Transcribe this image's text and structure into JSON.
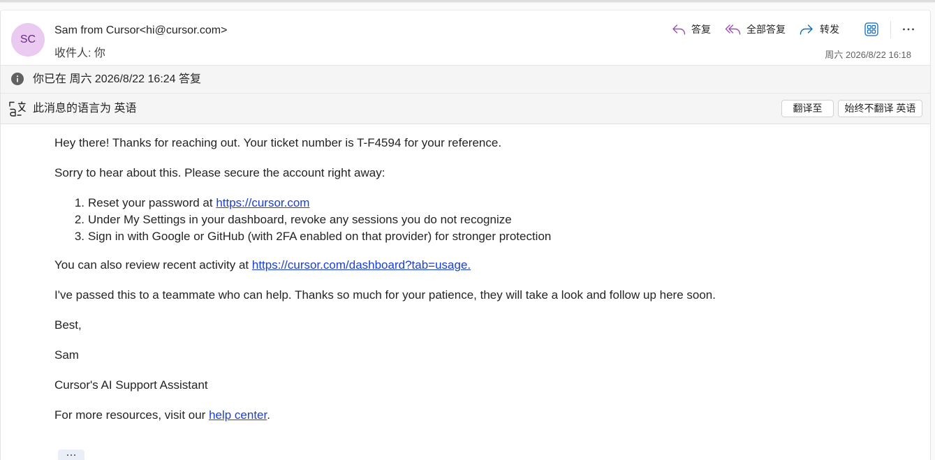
{
  "theme": {
    "avatar_bg": "#ebcaf1",
    "avatar_text": "#6d2a85",
    "reply_icon": "#9c4db2",
    "forward_icon": "#0f6cbd",
    "link": "#1a3ed6",
    "bar_bg": "#f5f5f5"
  },
  "header": {
    "avatar_initials": "SC",
    "sender": "Sam from Cursor<hi@cursor.com>",
    "recipient_label": "收件人:",
    "recipient": "你",
    "timestamp": "周六 2026/8/22 16:18"
  },
  "actions": [
    {
      "label": "答复",
      "icon": "reply-icon"
    },
    {
      "label": "全部答复",
      "icon": "reply-all-icon"
    },
    {
      "label": "转发",
      "icon": "forward-icon"
    }
  ],
  "toolbar_icons": [
    "apps-icon",
    "more-icon"
  ],
  "info_bar": {
    "icon": "info-icon",
    "text": "你已在 周六 2026/8/22 16:24 答复"
  },
  "translation_bar": {
    "icon": "translate-icon",
    "text": "此消息的语言为 英语",
    "translate_button": "翻译至",
    "never_translate_button": "始终不翻译 英语"
  },
  "body": {
    "greeting": "Hey there! Thanks for reaching out. Your ticket number is T-F4594 for your reference.",
    "intro": "Sorry to hear about this. Please secure the account right away:",
    "steps": [
      {
        "marker": "1.",
        "text": "Reset your password at ",
        "link": "https://cursor.com"
      },
      {
        "marker": "2.",
        "text": "Under My Settings in your dashboard, revoke any sessions you do not recognize"
      },
      {
        "marker": "3.",
        "text": "Sign in with Google or GitHub (with 2FA enabled on that provider) for stronger protection"
      }
    ],
    "activity": {
      "prefix": "You can also review recent activity at ",
      "link": "https://cursor.com/dashboard?tab=usage."
    },
    "handoff": "I've passed this to a teammate who can help. Thanks so much for your patience, they will take a look and follow up here soon.",
    "signoff": "Best,",
    "name": "Sam",
    "role": "Cursor's AI Support Assistant",
    "resources": {
      "prefix": "For more resources, visit our ",
      "link": "help center",
      "suffix": "."
    }
  },
  "expand_button": {
    "icon": "ellipsis-icon"
  }
}
